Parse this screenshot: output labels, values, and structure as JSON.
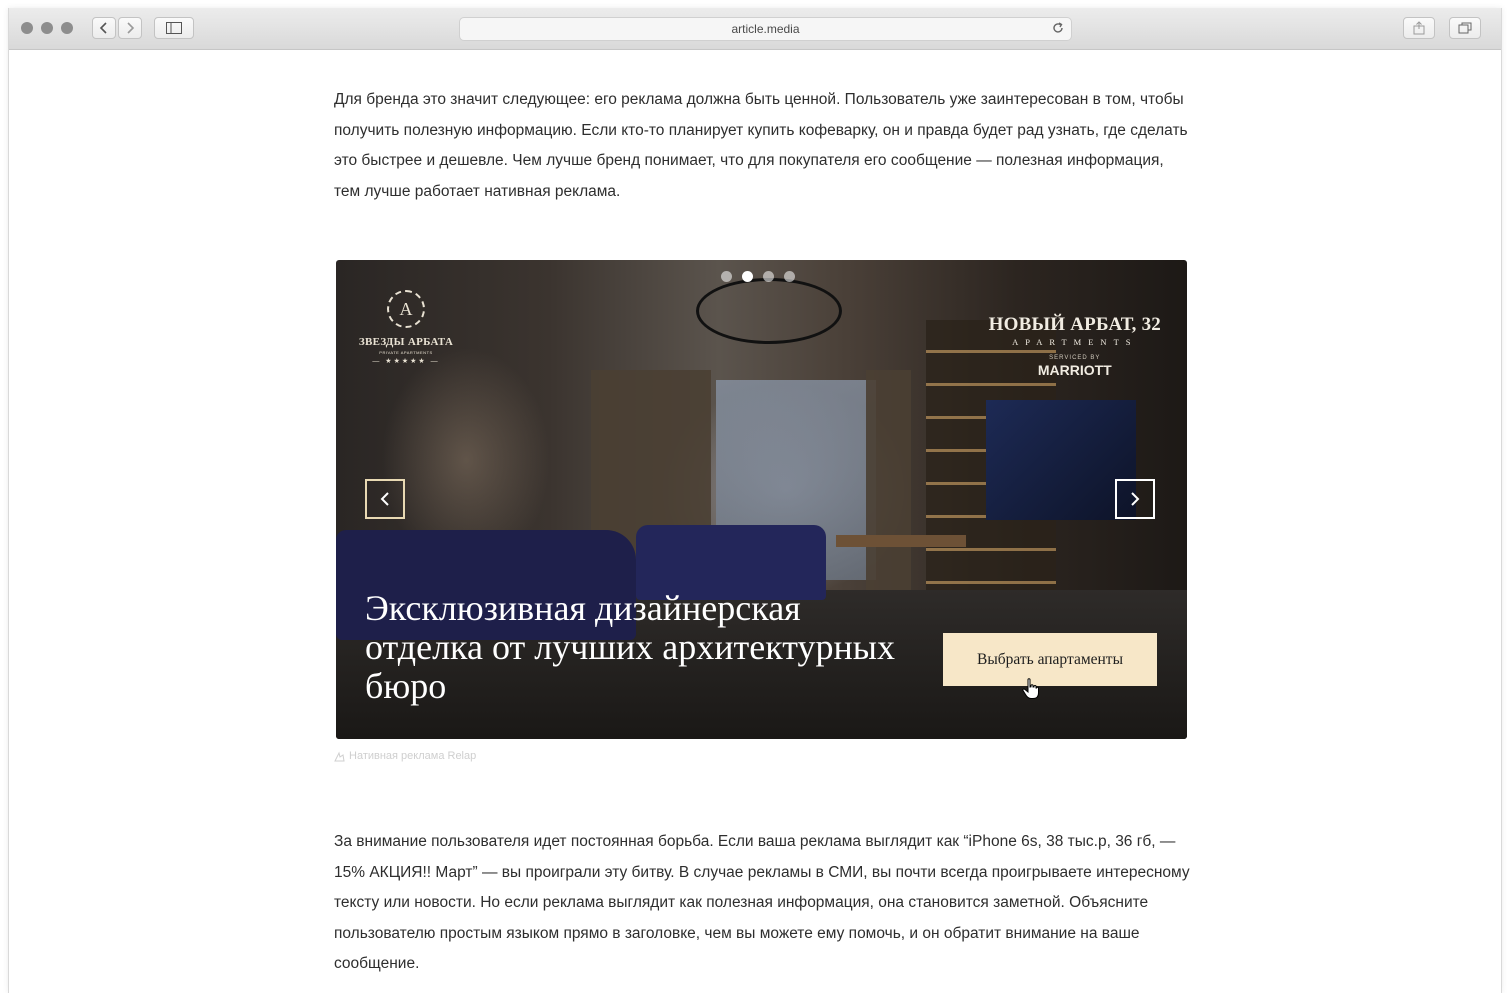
{
  "browser": {
    "url": "article.media",
    "icons": [
      "back-icon",
      "forward-icon",
      "sidebar-icon",
      "reload-icon",
      "share-icon",
      "tabs-icon"
    ]
  },
  "article": {
    "paragraph1": "Для бренда это значит следующее: его реклама должна быть ценной. Пользователь уже заинтересован в том, чтобы получить полезную информацию. Если кто-то планирует купить кофеварку, он и правда будет рад узнать, где сделать это быстрее и дешевле. Чем лучше бренд понимает, что для покупателя его сообщение — полезная информация, тем лучше работает нативная реклама.",
    "paragraph2": "За внимание пользователя идет постоянная борьба. Если ваша реклама выглядит как “iPhone 6s, 38 тыс.р, 36 гб, — 15% АКЦИЯ!! Март” — вы проиграли эту битву. В случае рекламы в СМИ, вы почти всегда проигрываете интересному тексту или новости. Но если реклама выглядит как полезная информация, она становится заметной. Объясните пользователю простым языком прямо в заголовке, чем вы можете ему помочь, и он обратит внимание на ваше сообщение.",
    "caption": "Нативная реклама Relap"
  },
  "banner": {
    "slides_total": 4,
    "active_slide": 2,
    "logo_left_letter": "A",
    "logo_left_name": "ЗВЕЗДЫ АРБАТА",
    "logo_left_sub": "PRIVATE APARTMENTS",
    "logo_right_title": "НОВЫЙ АРБАТ, 32",
    "logo_right_sub": "APARTMENTS",
    "logo_right_serviced": "SERVICED BY",
    "logo_right_brand": "MARRIOTT",
    "headline": "Эксклюзивная дизайнерская отделка от лучших архитектурных бюро",
    "cta_label": "Выбрать апартаменты",
    "colors": {
      "cta_bg": "#f7e7c8",
      "arrow_border": "#e8d9b3"
    }
  }
}
